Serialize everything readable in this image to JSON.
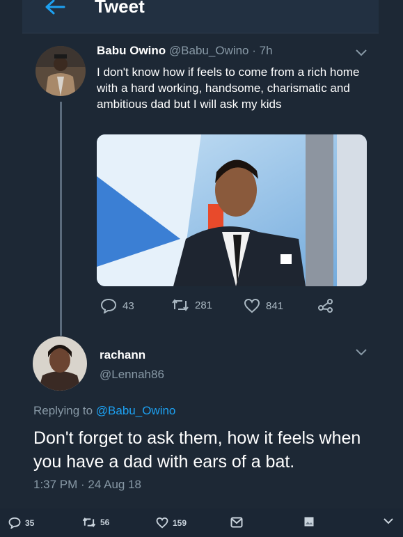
{
  "header": {
    "title": "Tweet",
    "back_icon": "arrow-left-icon"
  },
  "tweet": {
    "author_name": "Babu Owino",
    "author_handle": "@Babu_Owino",
    "separator": " · ",
    "time_ago": "7h",
    "text": "I don't know how if feels to come from a rich home with a hard working, handsome, charismatic and ambitious dad but I will ask my kids",
    "replies": "43",
    "retweets": "281",
    "likes": "841"
  },
  "reply": {
    "author_name": "rachann",
    "author_handle": "@Lennah86",
    "replying_prefix": "Replying to ",
    "replying_to": "@Babu_Owino",
    "text": "Don't forget to ask them, how it feels when you have a dad with ears of a bat.",
    "timestamp": "1:37 PM · 24 Aug 18"
  },
  "bottom_bar": {
    "replies": "35",
    "retweets": "56",
    "likes": "159"
  },
  "colors": {
    "background": "#1d2835",
    "accent": "#1da1f2",
    "muted": "#8899a6"
  }
}
